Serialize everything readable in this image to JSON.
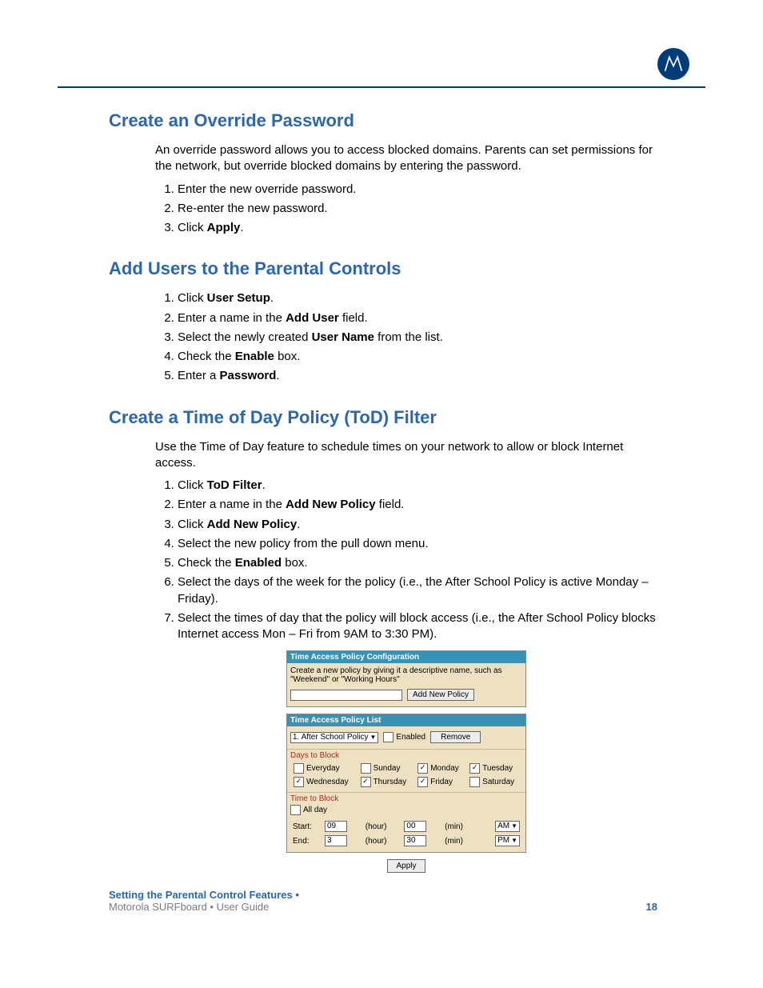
{
  "section1": {
    "title": "Create an Override Password",
    "intro": "An override password allows you to access blocked domains. Parents can set permissions for the network, but override blocked domains by entering the password.",
    "steps": {
      "s1": "Enter the new override password.",
      "s2": "Re-enter the new password.",
      "s3_pre": "Click ",
      "s3_b": "Apply",
      "s3_post": "."
    }
  },
  "section2": {
    "title": "Add Users to the Parental Controls",
    "steps": {
      "s1_pre": "Click ",
      "s1_b": "User Setup",
      "s1_post": ".",
      "s2_pre": "Enter a name in the ",
      "s2_b": "Add User",
      "s2_post": " field.",
      "s3_pre": "Select the newly created ",
      "s3_b": "User Name",
      "s3_post": " from the list.",
      "s4_pre": "Check the ",
      "s4_b": "Enable",
      "s4_post": " box.",
      "s5_pre": "Enter a ",
      "s5_b": "Password",
      "s5_post": "."
    }
  },
  "section3": {
    "title": "Create a Time of Day Policy (ToD) Filter",
    "intro": "Use the Time of Day feature to schedule times on your network to allow or block Internet access.",
    "steps": {
      "s1_pre": "Click ",
      "s1_b": "ToD Filter",
      "s1_post": ".",
      "s2_pre": "Enter a name in the ",
      "s2_b": "Add New Policy",
      "s2_post": " field.",
      "s3_pre": "Click ",
      "s3_b": "Add New Policy",
      "s3_post": ".",
      "s4": "Select the new policy from the pull down menu.",
      "s5_pre": "Check the ",
      "s5_b": "Enabled",
      "s5_post": " box.",
      "s6": "Select the days of the week for the policy (i.e., the After School Policy is active Monday – Friday).",
      "s7": "Select the times of day that the policy will block access (i.e., the After School Policy blocks Internet access Mon – Fri from 9AM to 3:30 PM)."
    }
  },
  "ui": {
    "hdr1": "Time Access Policy Configuration",
    "desc": "Create a new policy by giving it a descriptive name, such as \"Weekend\" or \"Working Hours\"",
    "add_btn": "Add New Policy",
    "hdr2": "Time Access Policy List",
    "policy_sel": "1. After School Policy",
    "enabled_label": "Enabled",
    "remove_btn": "Remove",
    "days_label": "Days to Block",
    "time_label": "Time to Block",
    "days": {
      "everyday": "Everyday",
      "sunday": "Sunday",
      "monday": "Monday",
      "tuesday": "Tuesday",
      "wednesday": "Wednesday",
      "thursday": "Thursday",
      "friday": "Friday",
      "saturday": "Saturday"
    },
    "allday": "All day",
    "start_label": "Start:",
    "end_label": "End:",
    "hour_label": "(hour)",
    "min_label": "(min)",
    "start_hour": "09",
    "start_min": "00",
    "end_hour": "3",
    "end_min": "30",
    "am": "AM",
    "pm": "PM",
    "apply": "Apply"
  },
  "footer": {
    "l1": "Setting the Parental Control Features •",
    "l2": "Motorola SURFboard • User Guide",
    "page": "18"
  }
}
